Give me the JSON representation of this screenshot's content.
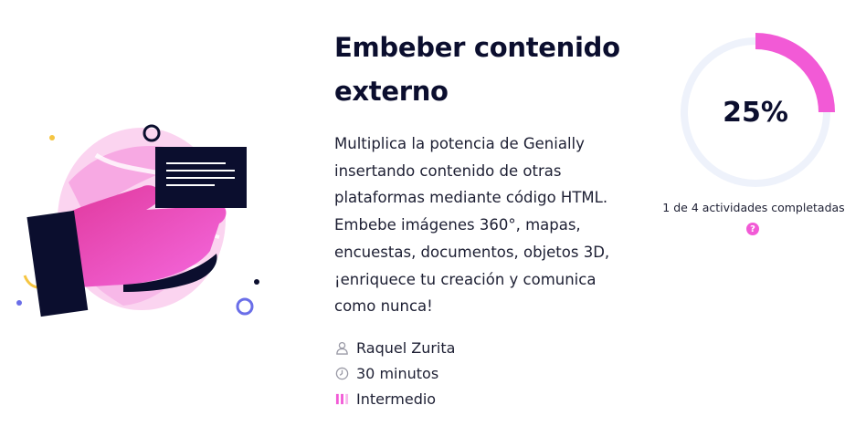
{
  "course": {
    "title": "Embeber contenido externo",
    "description": "Multiplica la potencia de Genially insertando contenido de otras plataformas mediante código HTML. Embebe imágenes 360°, mapas, encuestas, documentos, objetos 3D, ¡enriquece tu creación y comunica como nunca!",
    "author": "Raquel Zurita",
    "duration": "30 minutos",
    "level": "Intermedio"
  },
  "progress": {
    "percent_label": "25%",
    "fraction": 0.25,
    "caption": "1 de 4 actividades completadas",
    "help_glyph": "?"
  },
  "icons": {
    "author": "user-icon",
    "duration": "clock-icon",
    "level": "level-bars-icon",
    "help": "help-icon"
  },
  "colors": {
    "accent": "#f25ad6",
    "dark": "#0b0e2e",
    "track": "#eef2fb",
    "icon_gray": "#9a9aa6"
  }
}
